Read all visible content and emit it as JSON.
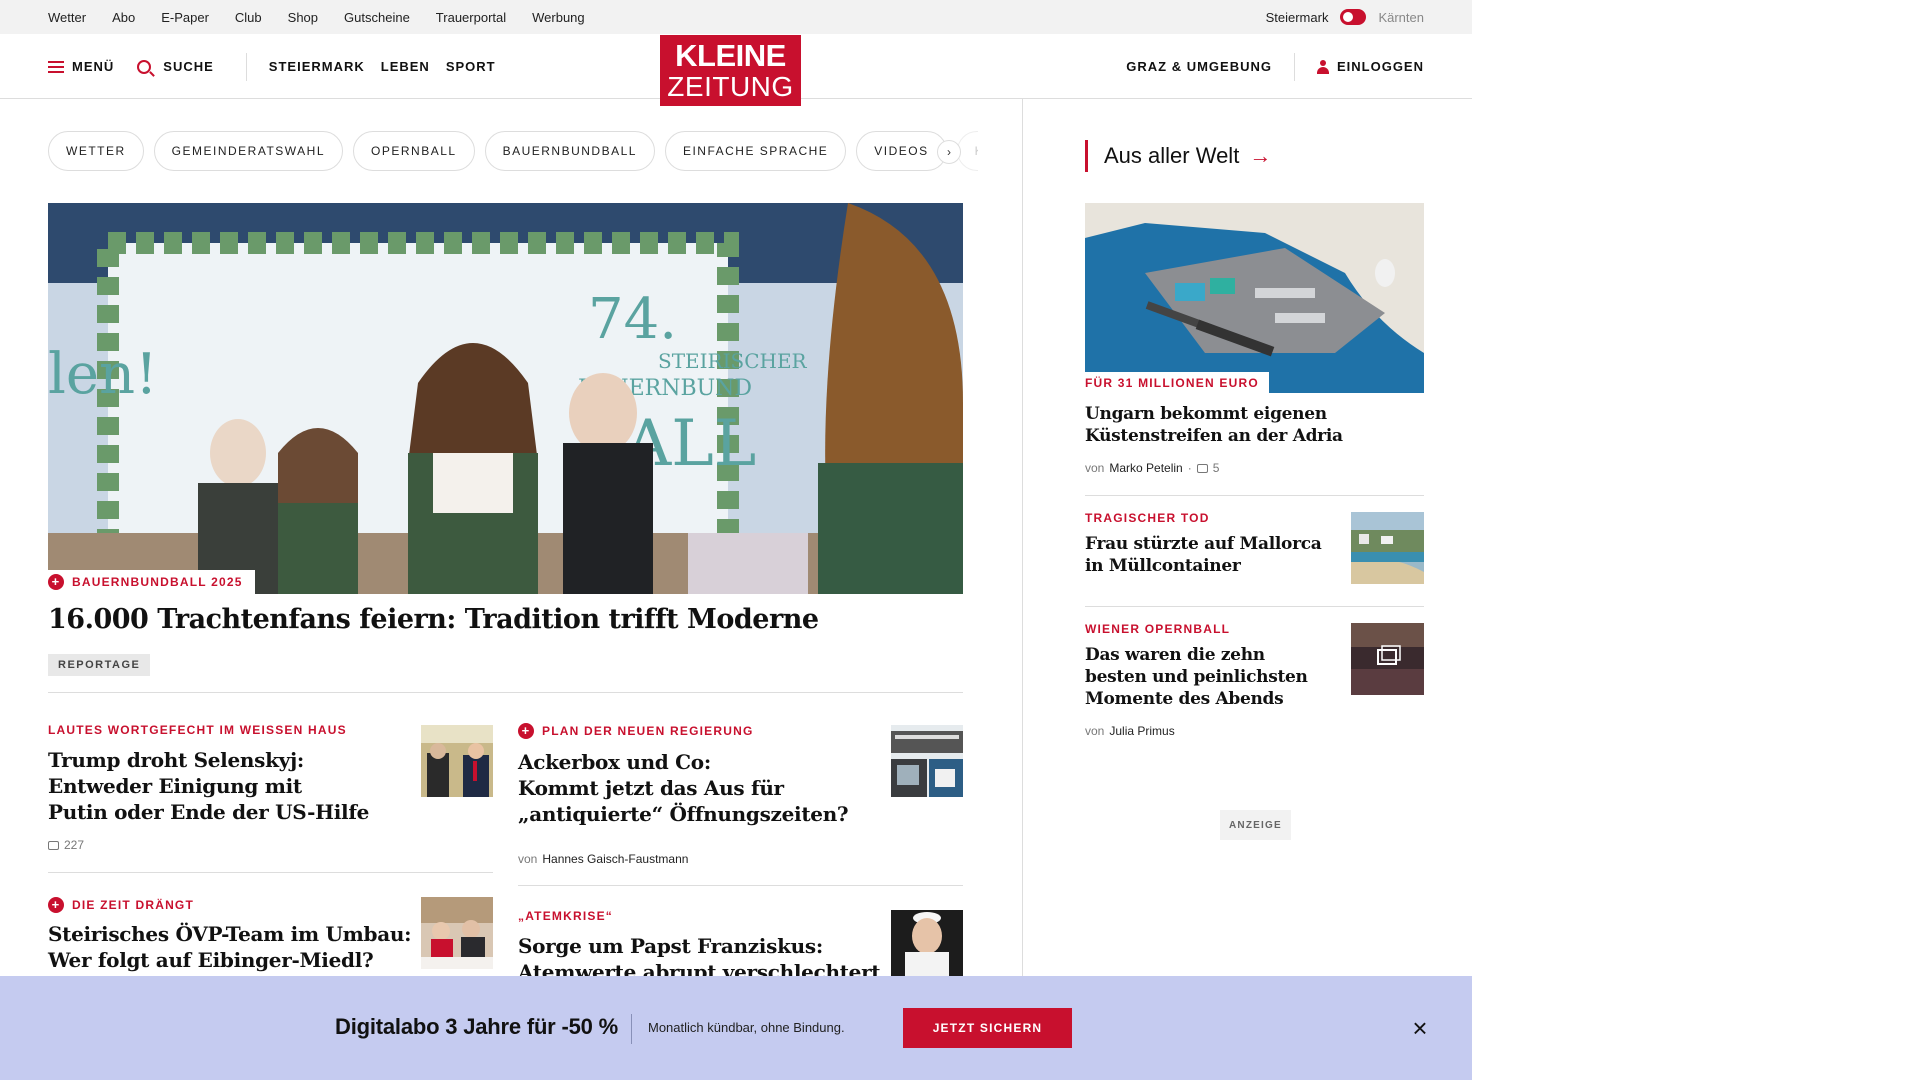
{
  "util": {
    "links": [
      "Wetter",
      "Abo",
      "E-Paper",
      "Club",
      "Shop",
      "Gutscheine",
      "Trauerportal",
      "Werbung"
    ],
    "region_left": "Steiermark",
    "region_right": "Kärnten"
  },
  "nav": {
    "menu": "MENÜ",
    "search": "SUCHE",
    "sections": [
      "STEIERMARK",
      "LEBEN",
      "SPORT"
    ],
    "logo_line1": "KLEINE",
    "logo_line2": "ZEITUNG",
    "local": "GRAZ & UMGEBUNG",
    "login": "EINLOGGEN"
  },
  "chips": [
    "WETTER",
    "GEMEINDERATSWAHL",
    "OPERNBALL",
    "BAUERNBUNDBALL",
    "EINFACHE SPRACHE",
    "VIDEOS",
    "K"
  ],
  "chips_next": "›",
  "hero": {
    "img_text1": "74.",
    "img_text2": "STEIRISCHER",
    "img_text3": "BAUERNBUND",
    "img_text4": "BALL",
    "img_text5": "len!",
    "kicker": "BAUERNBUNDBALL 2025",
    "title": "16.000 Trachtenfans feiern: Tradition trifft Moderne",
    "badge": "REPORTAGE"
  },
  "articles": [
    {
      "kicker": "LAUTES WORTGEFECHT IM WEISSEN HAUS",
      "title_lines": [
        "Trump droht Selenskyj:",
        "Entweder Einigung mit",
        "Putin oder Ende der US-Hilfe"
      ],
      "comments": "227"
    },
    {
      "kicker": "PLAN DER NEUEN REGIERUNG",
      "title_lines": [
        "Ackerbox und Co:",
        "Kommt jetzt das Aus für",
        "„antiquierte“ Öffnungszeiten?"
      ],
      "author_prefix": "von",
      "author": "Hannes Gaisch-Faustmann"
    },
    {
      "kicker": "DIE ZEIT DRÄNGT",
      "title_lines": [
        "Steirisches ÖVP-Team im Umbau:",
        "Wer folgt auf Eibinger-Miedl?"
      ]
    },
    {
      "kicker": "„ATEMKRISE“",
      "title_lines": [
        "Sorge um Papst Franziskus:",
        "Atemwerte abrupt verschlechtert"
      ]
    }
  ],
  "sidebar": {
    "section_title": "Aus aller Welt",
    "section_arrow": "→",
    "lead": {
      "kicker": "FÜR 31 MILLIONEN EURO",
      "title_lines": [
        "Ungarn bekommt eigenen",
        "Küstenstreifen an der Adria"
      ],
      "author_prefix": "von",
      "author": "Marko Petelin",
      "comments": "5"
    },
    "items": [
      {
        "kicker": "TRAGISCHER TOD",
        "title_lines": [
          "Frau stürzte auf Mallorca",
          "in Müllcontainer"
        ]
      },
      {
        "kicker": "WIENER OPERNBALL",
        "title_lines": [
          "Das waren die zehn",
          "besten und peinlichsten",
          "Momente des Abends"
        ],
        "author_prefix": "von",
        "author": "Julia Primus"
      }
    ],
    "ad_label": "ANZEIGE"
  },
  "banner": {
    "title": "Digitalabo 3 Jahre für -50 %",
    "subtitle": "Monatlich kündbar, ohne Bindung.",
    "button": "JETZT SICHERN",
    "close": "×"
  },
  "colors": {
    "brand_red": "#c8102e",
    "banner_bg": "#c5cbf0"
  }
}
